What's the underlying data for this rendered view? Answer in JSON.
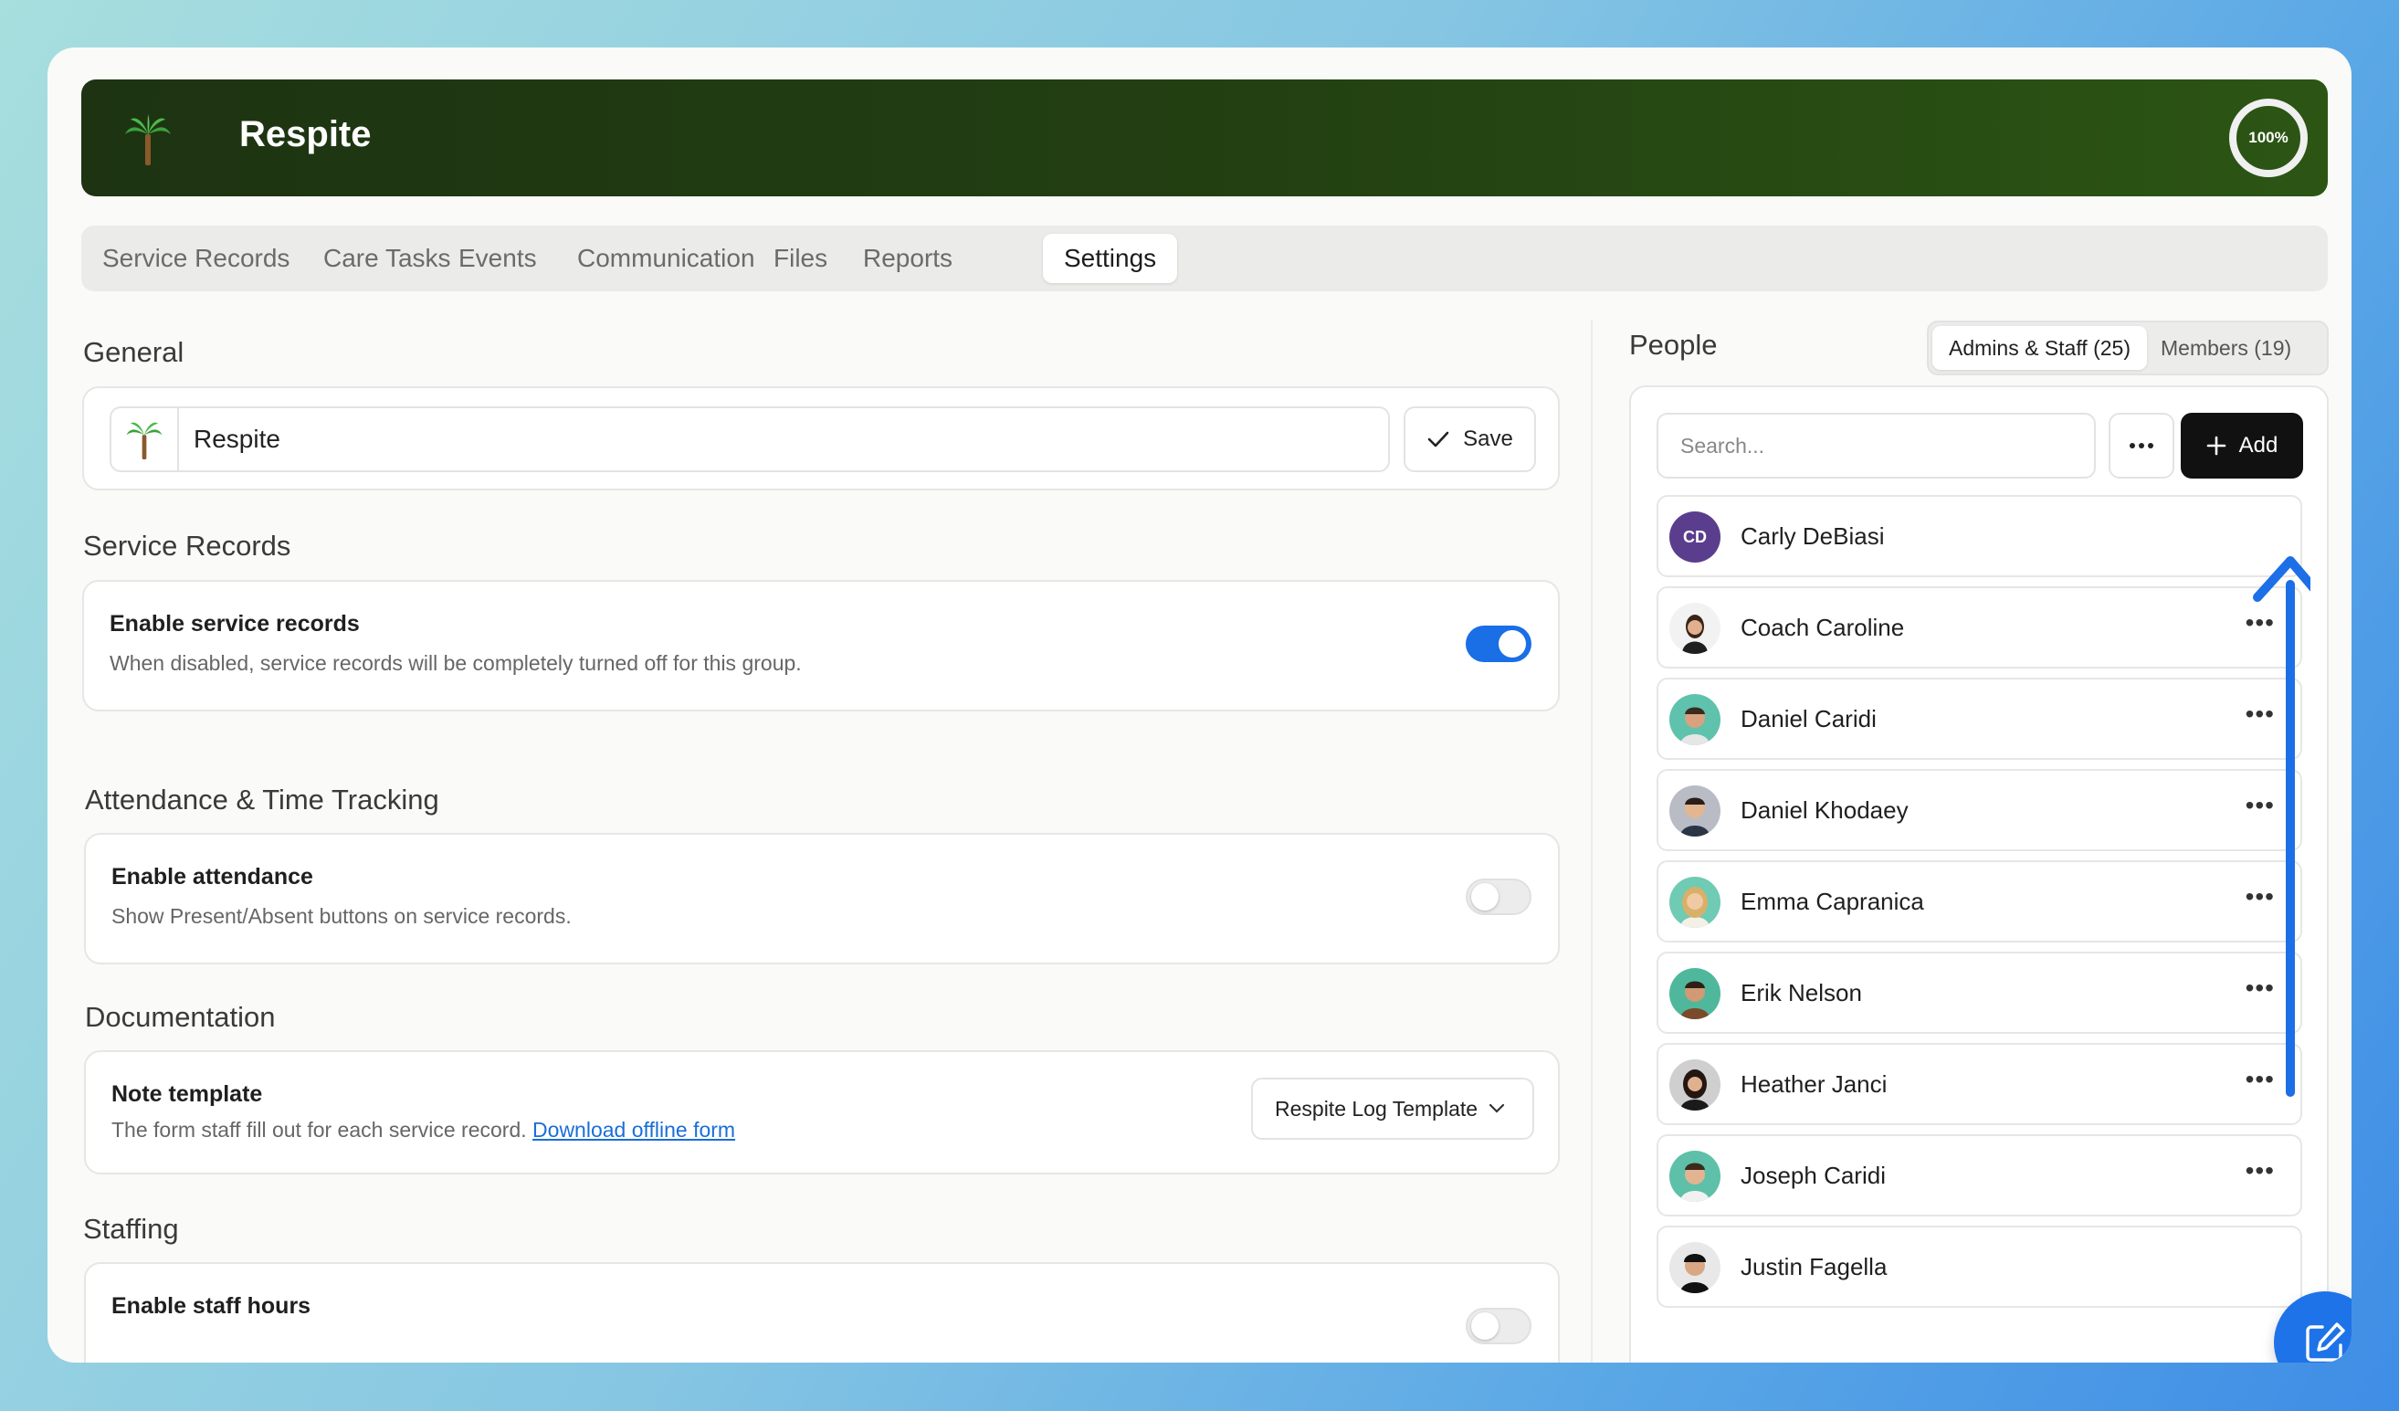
{
  "header": {
    "title": "Respite",
    "progress": "100%"
  },
  "tabs": [
    {
      "label": "Service Records"
    },
    {
      "label": "Care Tasks"
    },
    {
      "label": "Events"
    },
    {
      "label": "Communication"
    },
    {
      "label": "Files"
    },
    {
      "label": "Reports"
    },
    {
      "label": "Settings",
      "active": true
    }
  ],
  "general": {
    "title": "General",
    "name_value": "Respite",
    "save_label": "Save"
  },
  "service_records": {
    "title": "Service Records",
    "label": "Enable service records",
    "desc": "When disabled, service records will be completely turned off for this group.",
    "enabled": true
  },
  "attendance": {
    "title": "Attendance & Time Tracking",
    "label": "Enable attendance",
    "desc": "Show Present/Absent buttons on service records.",
    "enabled": false
  },
  "documentation": {
    "title": "Documentation",
    "label": "Note template",
    "desc": "The form staff fill out for each service record.",
    "link": "Download offline form",
    "template": "Respite Log Template"
  },
  "staffing": {
    "title": "Staffing",
    "label": "Enable staff hours",
    "enabled": false
  },
  "people": {
    "title": "People",
    "segments": [
      "Admins & Staff (25)",
      "Members (19)"
    ],
    "search_placeholder": "Search...",
    "add_label": "Add",
    "list": [
      {
        "name": "Carly DeBiasi",
        "initials": "CD"
      },
      {
        "name": "Coach Caroline"
      },
      {
        "name": "Daniel Caridi"
      },
      {
        "name": "Daniel Khodaey"
      },
      {
        "name": "Emma Capranica"
      },
      {
        "name": "Erik Nelson"
      },
      {
        "name": "Heather Janci"
      },
      {
        "name": "Joseph Caridi"
      },
      {
        "name": "Justin Fagella"
      }
    ]
  },
  "colors": {
    "accent": "#1a6ee6",
    "header_dark": "#1d3312",
    "header_light": "#2c5514"
  },
  "icons": [
    "palm-tree-icon",
    "check-icon",
    "chevron-down-icon",
    "more-icon",
    "plus-icon",
    "edit-icon"
  ]
}
